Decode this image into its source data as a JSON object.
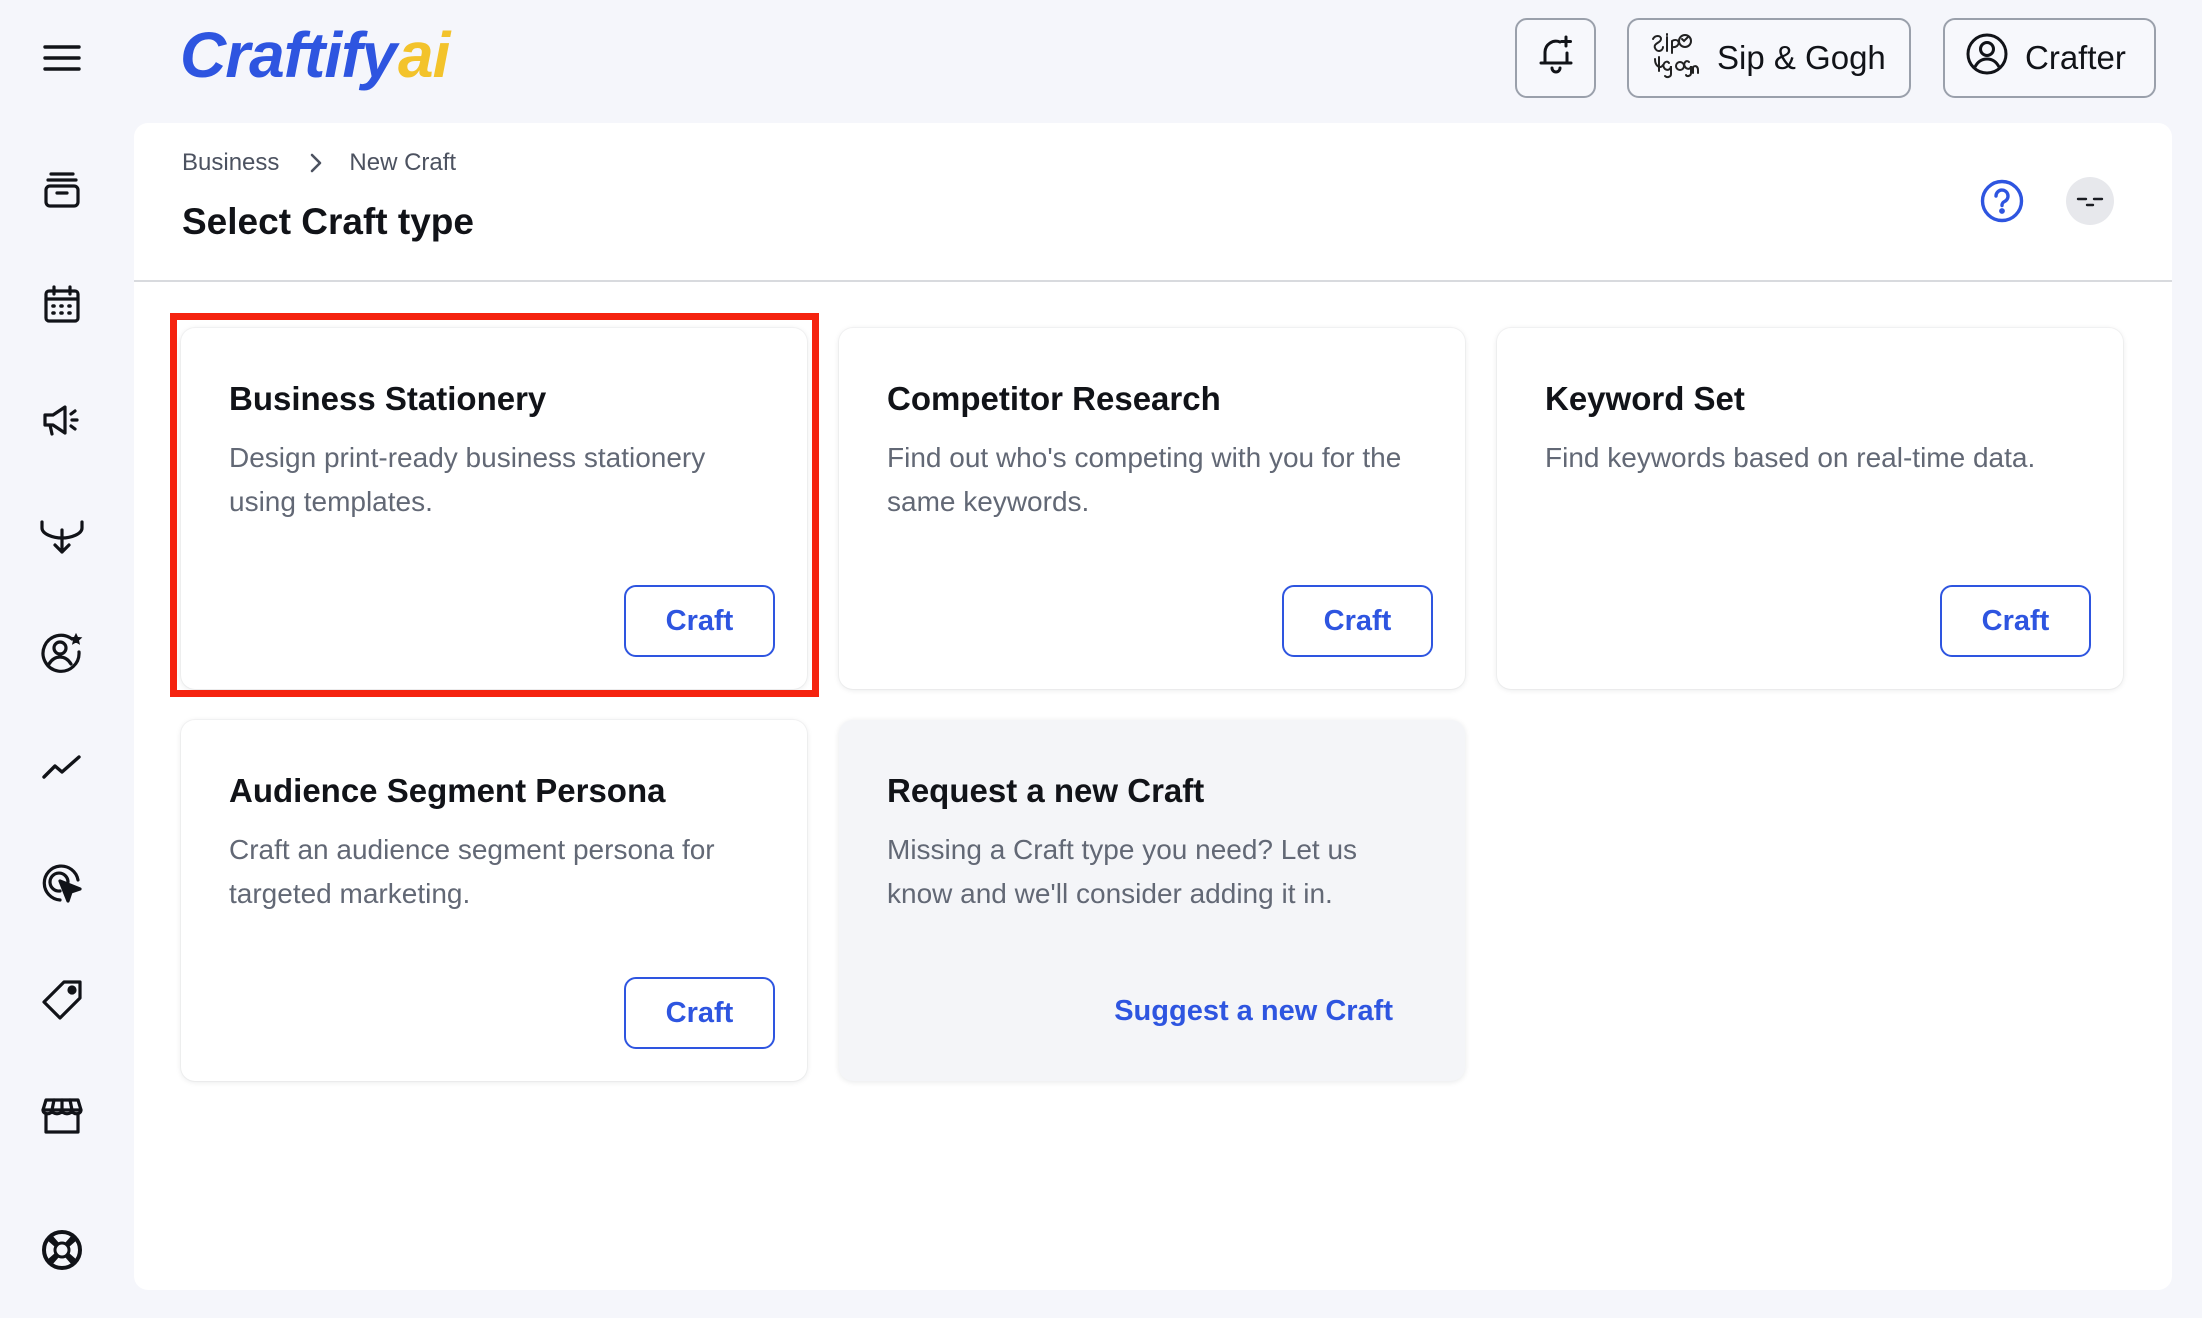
{
  "app": {
    "logo_main": "Craftify",
    "logo_suffix": "ai",
    "brand_color": "#2e55e0",
    "logo_accent_color": "#f3c32b"
  },
  "header": {
    "notification_icon": "bell-plus-icon",
    "org_logo_icon": "sip-and-gogh-logo",
    "org_name": "Sip & Gogh",
    "user_icon": "user-circle-icon",
    "user_name": "Crafter"
  },
  "sidebar": {
    "items": [
      {
        "icon": "archive-icon"
      },
      {
        "icon": "calendar-icon"
      },
      {
        "icon": "megaphone-icon"
      },
      {
        "icon": "funnel-icon"
      },
      {
        "icon": "user-star-icon"
      },
      {
        "icon": "trend-line-icon"
      },
      {
        "icon": "target-cursor-icon"
      },
      {
        "icon": "tag-icon"
      },
      {
        "icon": "store-icon"
      },
      {
        "icon": "lifebuoy-icon"
      }
    ]
  },
  "breadcrumb": {
    "items": [
      "Business",
      "New Craft"
    ]
  },
  "page": {
    "title": "Select Craft type",
    "help_icon": "help-circle-icon",
    "avatar_icon": "sleepy-face-avatar"
  },
  "cards": [
    {
      "title": "Business Stationery",
      "description": "Design print-ready business stationery using templates.",
      "button_label": "Craft"
    },
    {
      "title": "Competitor Research",
      "description": "Find out who's competing with you for the same keywords.",
      "button_label": "Craft"
    },
    {
      "title": "Keyword Set",
      "description": "Find keywords based on real-time data.",
      "button_label": "Craft"
    },
    {
      "title": "Audience Segment Persona",
      "description": "Craft an audience segment persona for targeted marketing.",
      "button_label": "Craft"
    }
  ],
  "request_card": {
    "title": "Request a new Craft",
    "description": "Missing a Craft type you need? Let us know and we'll consider adding it in.",
    "link_label": "Suggest a new Craft"
  },
  "highlight": {
    "color": "#f5230f",
    "target": "Business Stationery"
  }
}
